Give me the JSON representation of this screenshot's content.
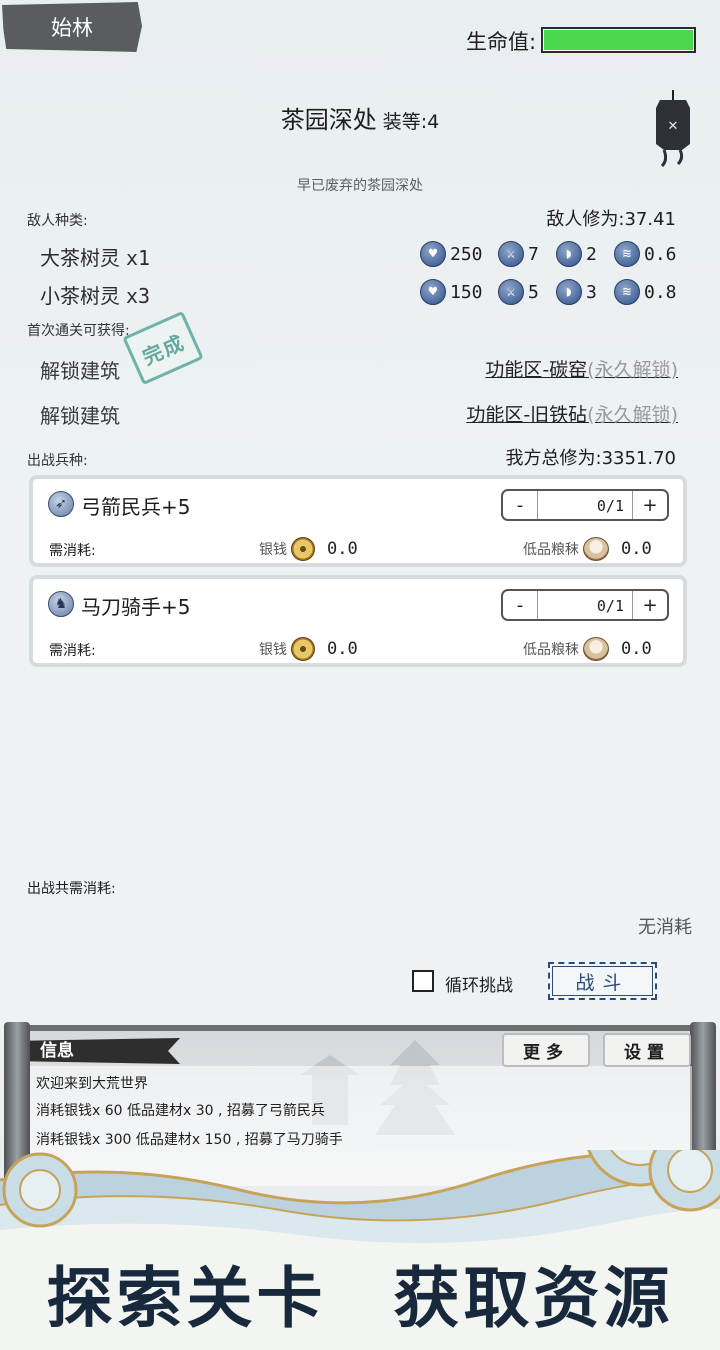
{
  "header": {
    "player_name": "始林",
    "hp_label": "生命值:",
    "hp_fraction": 1.0,
    "hp_color": "#4cd84c"
  },
  "stage": {
    "name": "茶园深处",
    "level_label": "装等:4",
    "description": "早已废弃的茶园深处"
  },
  "enemies": {
    "section_label": "敌人种类:",
    "power_label": "敌人修为:37.41",
    "list": [
      {
        "name": "大茶树灵",
        "count": "x1",
        "hp": "250",
        "atk": "7",
        "def": "2",
        "spd": "0.6"
      },
      {
        "name": "小茶树灵",
        "count": "x3",
        "hp": "150",
        "atk": "5",
        "def": "3",
        "spd": "0.8"
      }
    ]
  },
  "rewards": {
    "section_label": "首次通关可获得:",
    "stamp": "完成",
    "list": [
      {
        "label": "解锁建筑",
        "target": "功能区-碳窑",
        "note": "(永久解锁)"
      },
      {
        "label": "解锁建筑",
        "target": "功能区-旧铁砧",
        "note": "(永久解锁)"
      }
    ]
  },
  "troops": {
    "section_label": "出战兵种:",
    "power_label": "我方总修为:3351.70",
    "units": [
      {
        "name": "弓箭民兵+5",
        "count": "0/1",
        "cost_label": "需消耗:",
        "silver_label": "银钱",
        "silver": "0.0",
        "grain_label": "低品粮秣",
        "grain": "0.0"
      },
      {
        "name": "马刀骑手+5",
        "count": "0/1",
        "cost_label": "需消耗:",
        "silver_label": "银钱",
        "silver": "0.0",
        "grain_label": "低品粮秣",
        "grain": "0.0"
      }
    ],
    "minus": "-",
    "plus": "+"
  },
  "battle": {
    "total_label": "出战共需消耗:",
    "no_cost": "无消耗",
    "loop_label": "循环挑战",
    "fight_label": "战斗"
  },
  "messages": {
    "title": "信息",
    "more_btn": "更多",
    "settings_btn": "设置",
    "lines": [
      "欢迎来到大荒世界",
      "消耗银钱x 60 低品建材x 30 , 招募了弓箭民兵",
      "消耗银钱x 300 低品建材x 150 , 招募了马刀骑手"
    ]
  },
  "banner": {
    "left": "探索关卡",
    "right": "获取资源"
  },
  "icons": {
    "hp": "heart-icon",
    "atk": "sword-icon",
    "def": "shield-icon",
    "spd": "wing-icon",
    "silver": "coin-icon",
    "grain": "grain-icon"
  }
}
